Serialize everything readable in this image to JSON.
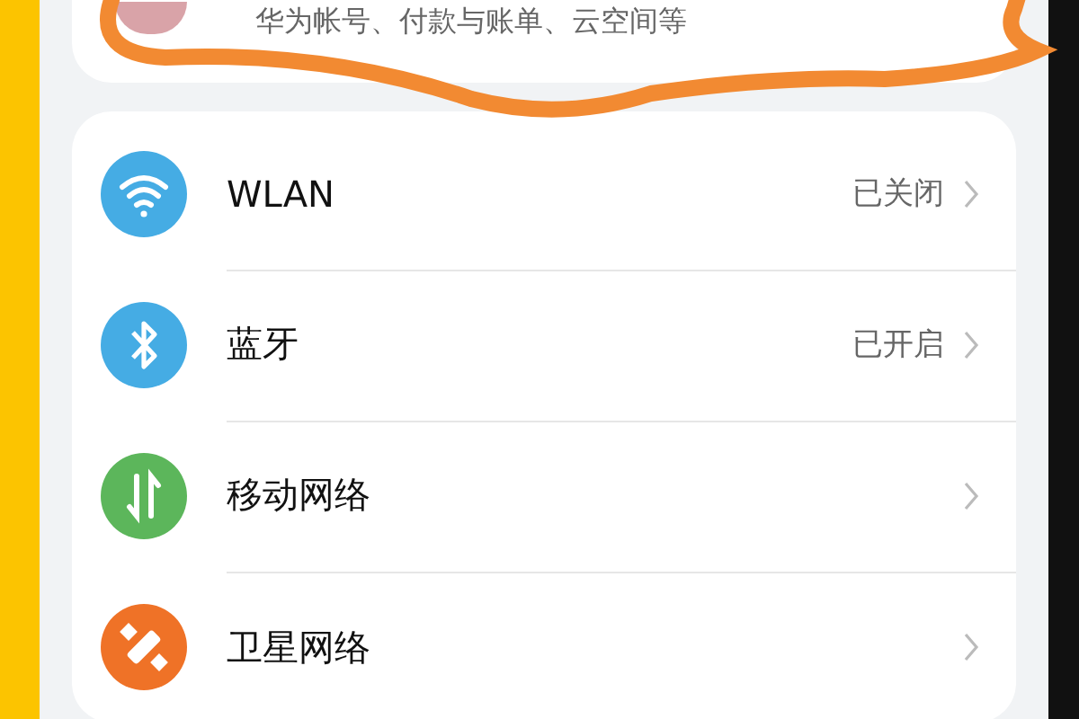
{
  "account_card": {
    "subtitle": "华为帐号、付款与账单、云空间等"
  },
  "settings": [
    {
      "kind": "wifi",
      "label": "WLAN",
      "status": "已关闭"
    },
    {
      "kind": "bluetooth",
      "label": "蓝牙",
      "status": "已开启"
    },
    {
      "kind": "mobile",
      "label": "移动网络"
    },
    {
      "kind": "satellite",
      "label": "卫星网络"
    }
  ]
}
